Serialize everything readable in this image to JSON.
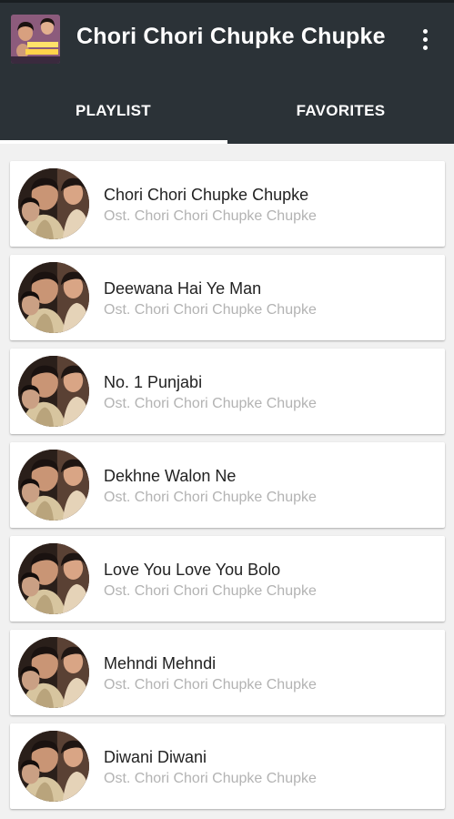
{
  "app": {
    "title": "Chori Chori Chupke Chupke",
    "logo_icon": "movie-poster-icon",
    "overflow_icon": "more-vert-icon"
  },
  "tabs": [
    {
      "label": "PLAYLIST",
      "selected": true
    },
    {
      "label": "FAVORITES",
      "selected": false
    }
  ],
  "songs": [
    {
      "title": "Chori Chori Chupke Chupke",
      "subtitle": "Ost. Chori Chori Chupke Chupke"
    },
    {
      "title": "Deewana Hai Ye Man",
      "subtitle": "Ost. Chori Chori Chupke Chupke"
    },
    {
      "title": "No. 1 Punjabi",
      "subtitle": "Ost. Chori Chori Chupke Chupke"
    },
    {
      "title": "Dekhne Walon Ne",
      "subtitle": "Ost. Chori Chori Chupke Chupke"
    },
    {
      "title": "Love You Love You Bolo",
      "subtitle": "Ost. Chori Chori Chupke Chupke"
    },
    {
      "title": "Mehndi Mehndi",
      "subtitle": "Ost. Chori Chori Chupke Chupke"
    },
    {
      "title": "Diwani Diwani",
      "subtitle": "Ost. Chori Chori Chupke Chupke"
    }
  ],
  "colors": {
    "appbar": "#2b3237",
    "title_text": "#222222",
    "subtitle_text": "#b3b3b3"
  }
}
